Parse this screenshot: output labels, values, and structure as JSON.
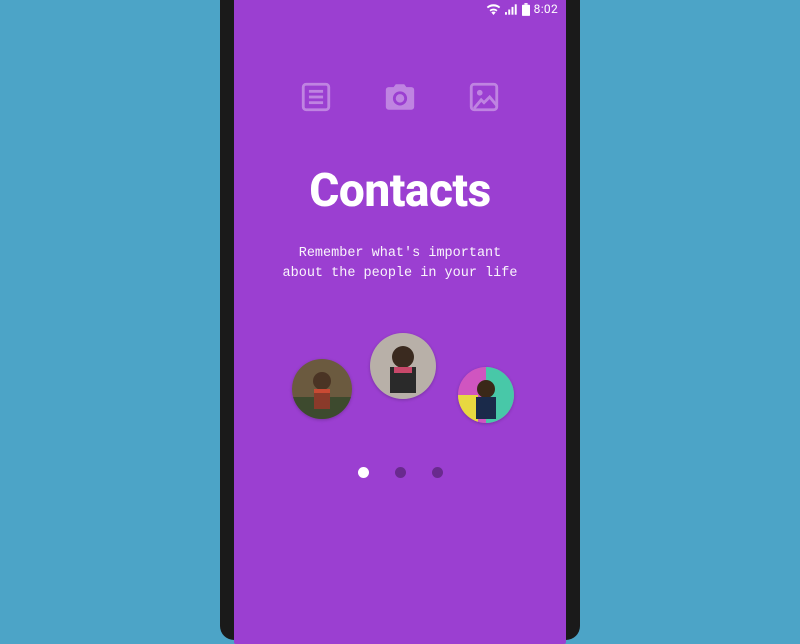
{
  "statusbar": {
    "time": "8:02"
  },
  "onboarding": {
    "title": "Contacts",
    "subtitle_line1": "Remember what's important",
    "subtitle_line2": "about the people in your life"
  },
  "pagination": {
    "total": 3,
    "active_index": 0
  },
  "colors": {
    "background": "#4ca4c7",
    "screen": "#9b3fd1",
    "dot_active": "#ffffff",
    "dot_inactive": "rgba(0,0,0,0.32)"
  }
}
